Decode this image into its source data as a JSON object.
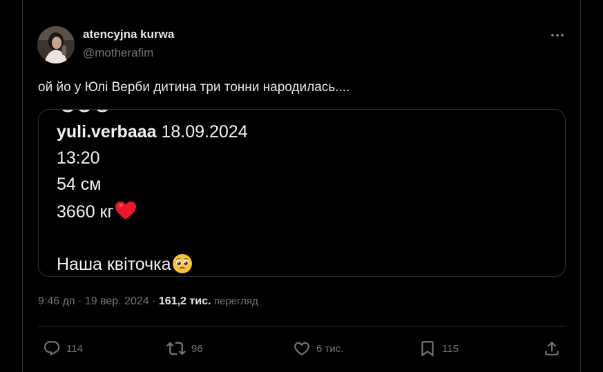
{
  "author": {
    "display_name": "atencyjna kurwa",
    "handle": "@motherafim"
  },
  "tweet": {
    "text": "ой йо у Юлі Верби дитина три тонни народилась....",
    "time": "9:46 дп",
    "date": "19 вер. 2024",
    "views_count": "161,2 тис.",
    "views_label": "перегляд"
  },
  "media": {
    "username": "yuli.verbaaa",
    "post_date": "18.09.2024",
    "time": "13:20",
    "length": "54 см",
    "weight": "3660 кг",
    "caption": "Наша квіточка"
  },
  "actions": {
    "replies": "114",
    "reposts": "96",
    "likes": "6 тис.",
    "bookmarks": "115"
  },
  "icons": {
    "more": "more-icon",
    "reply": "reply-icon",
    "repost": "repost-icon",
    "like": "heart-icon",
    "bookmark": "bookmark-icon",
    "share": "share-icon"
  },
  "colors": {
    "background": "#000000",
    "text": "#e7e9ea",
    "secondary_text": "#71767b",
    "border": "#2f3336",
    "heart_emoji": "#e8192c"
  }
}
